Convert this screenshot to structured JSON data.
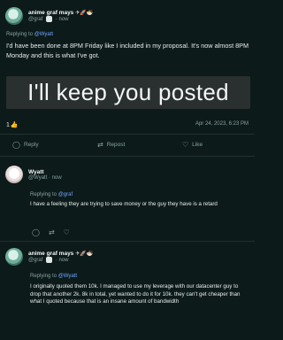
{
  "post1": {
    "name": "anime graf mays",
    "handle": "@graf",
    "time": "now",
    "emoji": "✈🚀🍜",
    "replying_label": "Replying to ",
    "replying_to": "@Wyatt",
    "text": "I'd have been done at 8PM Friday like I included in my proposal. It's now almost 8PM Monday and this is what I've got.",
    "image_text": "I'll keep you posted",
    "like_count": "1",
    "timestamp": "Apr 24, 2023, 6:23 PM",
    "actions": {
      "reply": "Reply",
      "repost": "Repost",
      "like": "Like"
    }
  },
  "post2": {
    "name": "Wyatt",
    "handle": "@Wyatt",
    "time": "now",
    "replying_label": "Replying to ",
    "replying_to": "@graf",
    "text": "I have a feeling they are trying to save money or the guy they have is a retard"
  },
  "post3": {
    "name": "anime graf mays",
    "handle": "@graf",
    "time": "now",
    "emoji": "✈🚀🍜",
    "replying_label": "Replying to ",
    "replying_to": "@Wyatt",
    "text": "I originally quoted them 10k. I managed to use my leverage with our datacenter guy to drop that another 2k. 8k in total, yet wanted to do it for 10k. they can't get cheaper than what I quoted because that is an insane amount of bandwidth"
  }
}
